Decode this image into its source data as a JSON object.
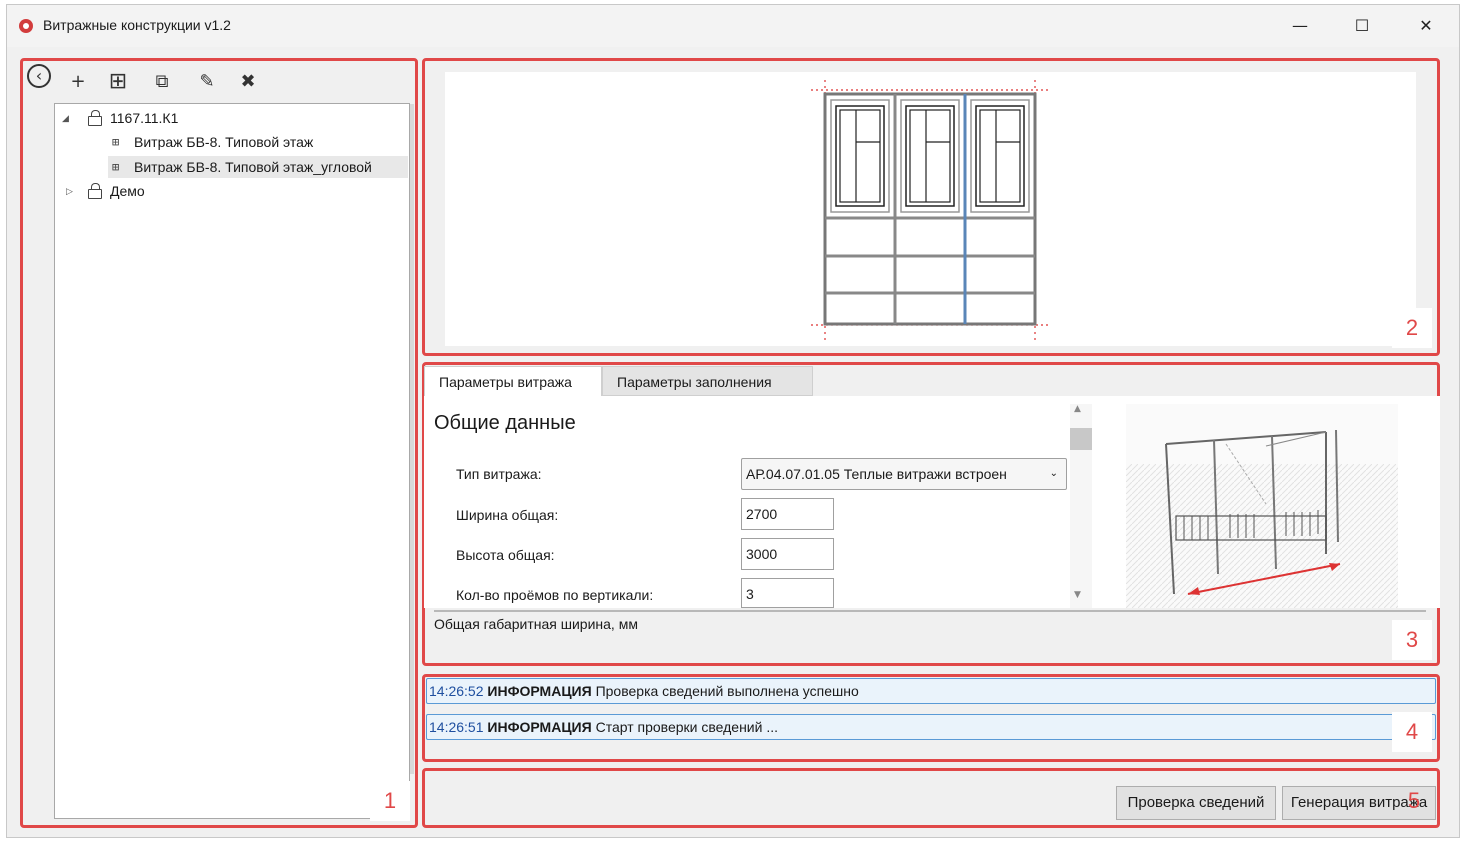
{
  "window": {
    "title": "Витражные конструкции v1.2",
    "controls": {
      "minimize": "—",
      "maximize": "☐",
      "close": "✕"
    }
  },
  "colors": {
    "accent_red": "#e04848",
    "selection_blue": "#5a9ad6",
    "timestamp_blue": "#1f4f9f"
  },
  "markers": [
    "1",
    "2",
    "3",
    "4",
    "5"
  ],
  "toolbar": {
    "icons": [
      "back-icon",
      "add-icon",
      "add-group-icon",
      "copy-icon",
      "edit-icon",
      "delete-icon"
    ],
    "glyphs": {
      "back": "‹",
      "add": "+",
      "add_group": "⊞",
      "copy": "⧉",
      "edit": "✎",
      "delete": "✖"
    }
  },
  "tree": {
    "nodes": [
      {
        "label": "1167.11.К1",
        "expanded": true
      },
      {
        "label": "Витраж БВ-8. Типовой этаж"
      },
      {
        "label": "Витраж БВ-8. Типовой этаж_угловой",
        "selected": true
      },
      {
        "label": "Демо",
        "expanded": false
      }
    ]
  },
  "tabs": [
    {
      "label": "Параметры витража",
      "active": true
    },
    {
      "label": "Параметры заполнения",
      "active": false
    }
  ],
  "params": {
    "section_title": "Общие данные",
    "fields": [
      {
        "label": "Тип витража:",
        "value": "АР.04.07.01.05 Теплые витражи встроен"
      },
      {
        "label": "Ширина общая:",
        "value": "2700"
      },
      {
        "label": "Высота общая:",
        "value": "3000"
      },
      {
        "label": "Кол-во проёмов по вертикали:",
        "value": "3"
      }
    ],
    "help_text": "Общая габаритная ширина, мм"
  },
  "log": [
    {
      "time": "14:26:52",
      "level": "ИНФОРМАЦИЯ",
      "message": "Проверка сведений выполнена успешно"
    },
    {
      "time": "14:26:51",
      "level": "ИНФОРМАЦИЯ",
      "message": "Старт проверки сведений ..."
    }
  ],
  "buttons": {
    "check": "Проверка сведений",
    "generate": "Генерация витража"
  }
}
